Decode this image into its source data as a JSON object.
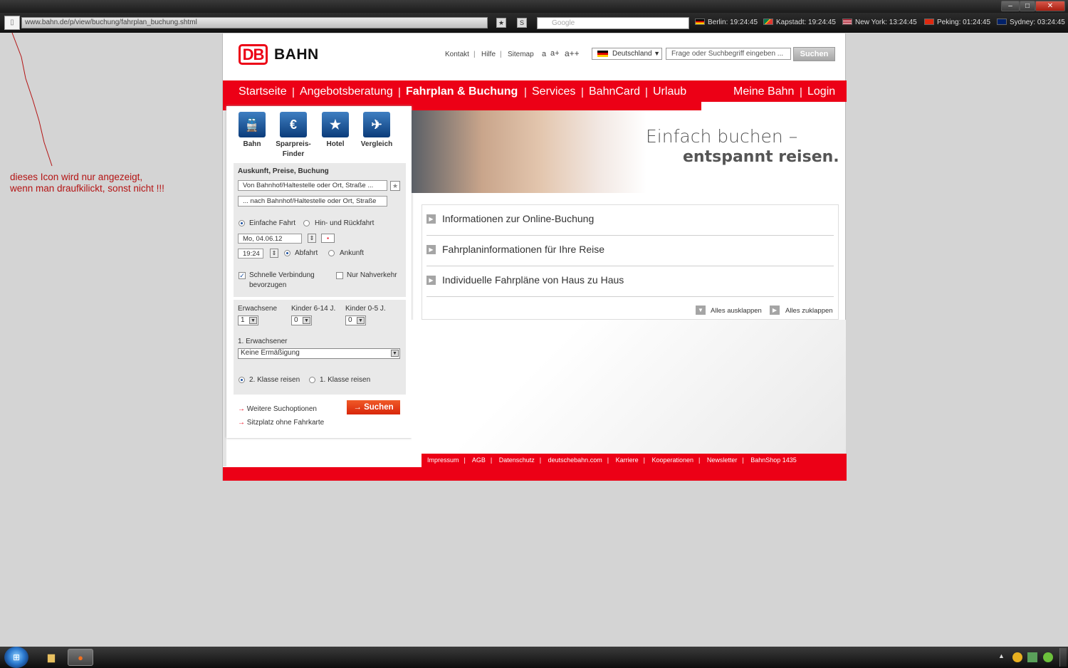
{
  "window": {
    "controls": [
      "–",
      "□",
      "✕"
    ]
  },
  "addressbar": {
    "url": "www.bahn.de/p/view/buchung/fahrplan_buchung.shtml",
    "search_placeholder": "Google"
  },
  "clocks": [
    {
      "city": "Berlin: 19:24:45",
      "flag": "de"
    },
    {
      "city": "Kapstadt: 19:24:45",
      "flag": "za"
    },
    {
      "city": "New York: 13:24:45",
      "flag": "us"
    },
    {
      "city": "Peking: 01:24:45",
      "flag": "cn"
    },
    {
      "city": "Sydney: 03:24:45",
      "flag": "au"
    }
  ],
  "annotation": {
    "line1": "dieses Icon wird nur angezeigt,",
    "line2": "wenn man draufkilickt, sonst nicht !!!"
  },
  "header": {
    "logo_db": "DB",
    "logo_bahn": "BAHN",
    "meta_links": [
      "Kontakt",
      "Hilfe",
      "Sitemap"
    ],
    "font_sizes": [
      "a",
      "a+",
      "a++"
    ],
    "country": "Deutschland",
    "search_placeholder": "Frage oder Suchbegriff eingeben ...",
    "search_button": "Suchen"
  },
  "nav": {
    "left": [
      "Startseite",
      "Angebotsberatung",
      "Fahrplan & Buchung",
      "Services",
      "BahnCard",
      "Urlaub"
    ],
    "right": [
      "Meine Bahn",
      "Login"
    ],
    "active": "Fahrplan & Buchung"
  },
  "products": [
    {
      "label": "Bahn",
      "icon": "train-icon"
    },
    {
      "label": "Sparpreis-",
      "label2": "Finder",
      "icon": "euro-train-icon"
    },
    {
      "label": "Hotel",
      "icon": "hotel-icon"
    },
    {
      "label": "Vergleich",
      "icon": "compare-icon"
    }
  ],
  "booking": {
    "section_title": "Auskunft, Preise, Buchung",
    "from_placeholder": "Von Bahnhof/Haltestelle oder Ort, Straße ...",
    "to_placeholder": "... nach Bahnhof/Haltestelle oder Ort, Straße",
    "trip_oneway": "Einfache Fahrt",
    "trip_return": "Hin- und Rückfahrt",
    "date": "Mo, 04.06.12",
    "time": "19:24",
    "departure": "Abfahrt",
    "arrival": "Ankunft",
    "fast_connection": "Schnelle Verbindung",
    "fast_connection2": "bevorzugen",
    "local_only": "Nur Nahverkehr",
    "adults_label": "Erwachsene",
    "kids614_label": "Kinder 6-14 J.",
    "kids05_label": "Kinder 0-5 J.",
    "adults": "1",
    "kids614": "0",
    "kids05": "0",
    "traveller1_label": "1. Erwachsener",
    "discount": "Keine Ermäßigung",
    "class2": "2. Klasse reisen",
    "class1": "1. Klasse reisen",
    "more_options": "Weitere Suchoptionen",
    "seat_only": "Sitzplatz ohne Fahrkarte",
    "search_button": "Suchen"
  },
  "hero": {
    "line1": "Einfach buchen –",
    "line2": "entspannt reisen."
  },
  "accordion": {
    "items": [
      "Informationen zur Online-Buchung",
      "Fahrplaninformationen für Ihre Reise",
      "Individuelle Fahrpläne von Haus zu Haus"
    ],
    "expand_all": "Alles ausklappen",
    "collapse_all": "Alles zuklappen"
  },
  "footer": {
    "links": [
      "Impressum",
      "AGB",
      "Datenschutz",
      "deutschebahn.com",
      "Karriere",
      "Kooperationen",
      "Newsletter",
      "BahnShop 1435"
    ]
  },
  "colors": {
    "db_red": "#ec0016",
    "button_orange": "#e5400f",
    "annotation_red": "#b41414"
  }
}
